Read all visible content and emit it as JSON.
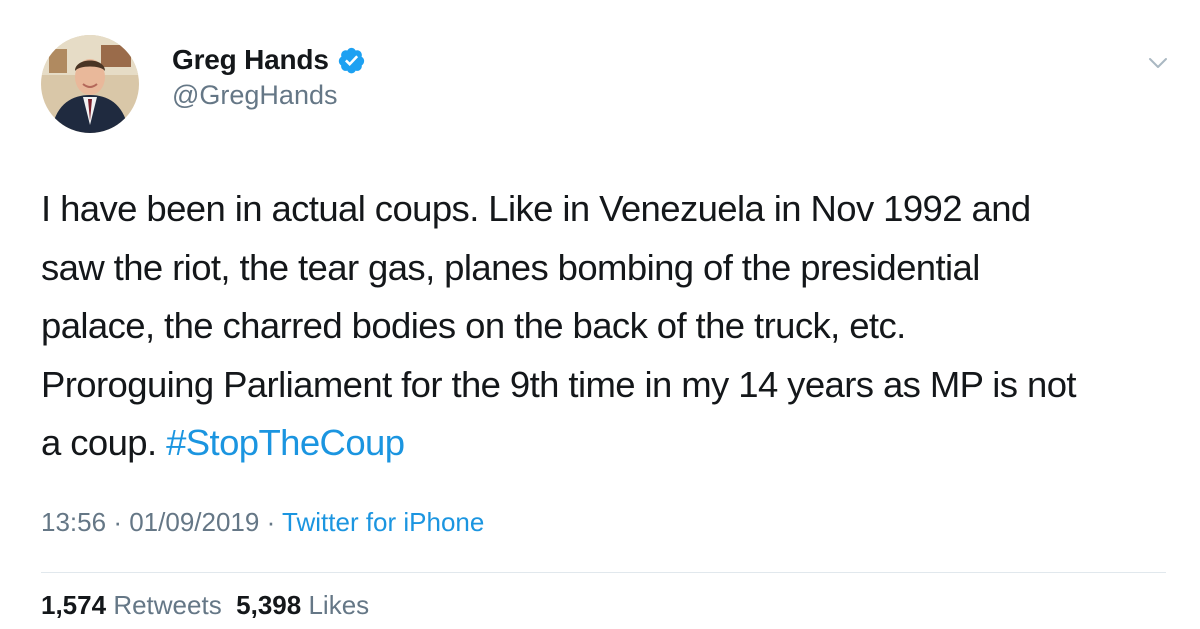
{
  "tweet": {
    "author": {
      "display_name": "Greg Hands",
      "handle": "@GregHands",
      "verified": true
    },
    "text_lines": [
      "I have been in actual coups. Like in Venezuela in Nov 1992 and",
      "saw the riot, the tear gas, planes bombing of the presidential",
      "palace, the charred bodies on the back of the truck, etc.",
      "Proroguing Parliament for the 9th time in my 14 years as MP is not"
    ],
    "last_line_text": "a coup. ",
    "hashtag": "#StopTheCoup",
    "time": "13:56",
    "date": "01/09/2019",
    "separator": "·",
    "source": "Twitter for iPhone",
    "retweets_count": "1,574",
    "retweets_label": "Retweets",
    "likes_count": "5,398",
    "likes_label": "Likes"
  },
  "icons": {
    "verified": "verified-badge-icon",
    "menu": "chevron-down-icon"
  },
  "colors": {
    "link": "#1b95e0",
    "secondary_text": "#657786",
    "primary_text": "#14171a",
    "divider": "#e1e8ed"
  }
}
